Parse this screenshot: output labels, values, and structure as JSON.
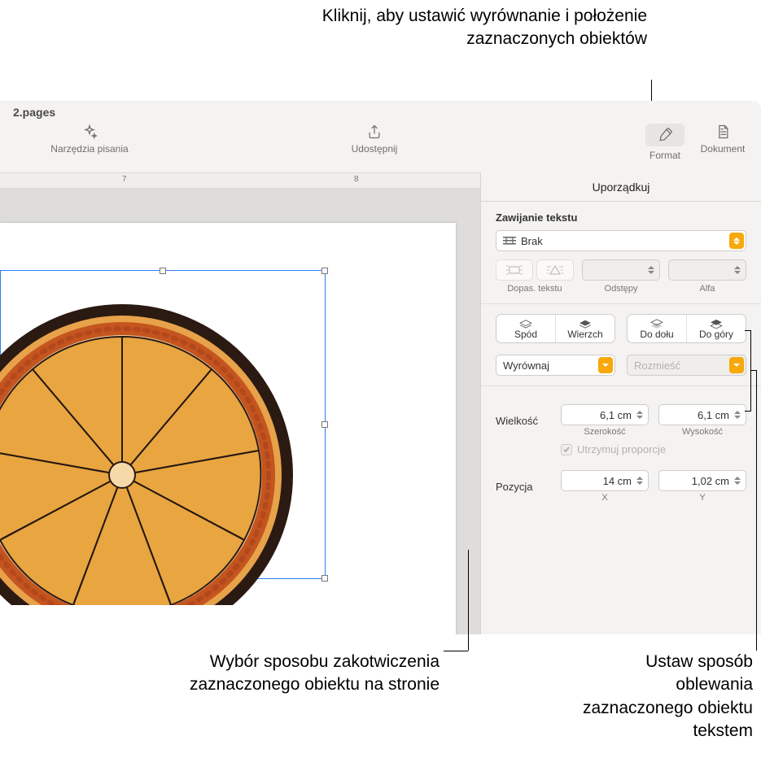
{
  "callouts": {
    "top": "Kliknij, aby ustawić wyrównanie i położenie zaznaczonych obiektów",
    "bottom_left": "Wybór sposobu zakotwiczenia zaznaczonego obiektu na stronie",
    "bottom_right": "Ustaw sposób oblewania zaznaczonego obiektu tekstem"
  },
  "window": {
    "filename": "2.pages"
  },
  "toolbar": {
    "writing_tools": "Narzędzia pisania",
    "share": "Udostępnij",
    "format": "Format",
    "document": "Dokument"
  },
  "ruler": {
    "marks": [
      "7",
      "8"
    ]
  },
  "inspector": {
    "tab": "Uporządkuj",
    "text_wrap": {
      "title": "Zawijanie tekstu",
      "value": "Brak",
      "fit_label": "Dopas. tekstu",
      "spacing_label": "Odstępy",
      "alpha_label": "Alfa"
    },
    "layers": {
      "back": "Spód",
      "front": "Wierzch",
      "backward": "Do dołu",
      "forward": "Do góry"
    },
    "align": {
      "align": "Wyrównaj",
      "distribute": "Rozmieść"
    },
    "size": {
      "label": "Wielkość",
      "width_value": "6,1 cm",
      "width_label": "Szerokość",
      "height_value": "6,1 cm",
      "height_label": "Wysokość",
      "constrain": "Utrzymuj proporcje"
    },
    "position": {
      "label": "Pozycja",
      "x_value": "14 cm",
      "x_label": "X",
      "y_value": "1,02 cm",
      "y_label": "Y"
    }
  }
}
